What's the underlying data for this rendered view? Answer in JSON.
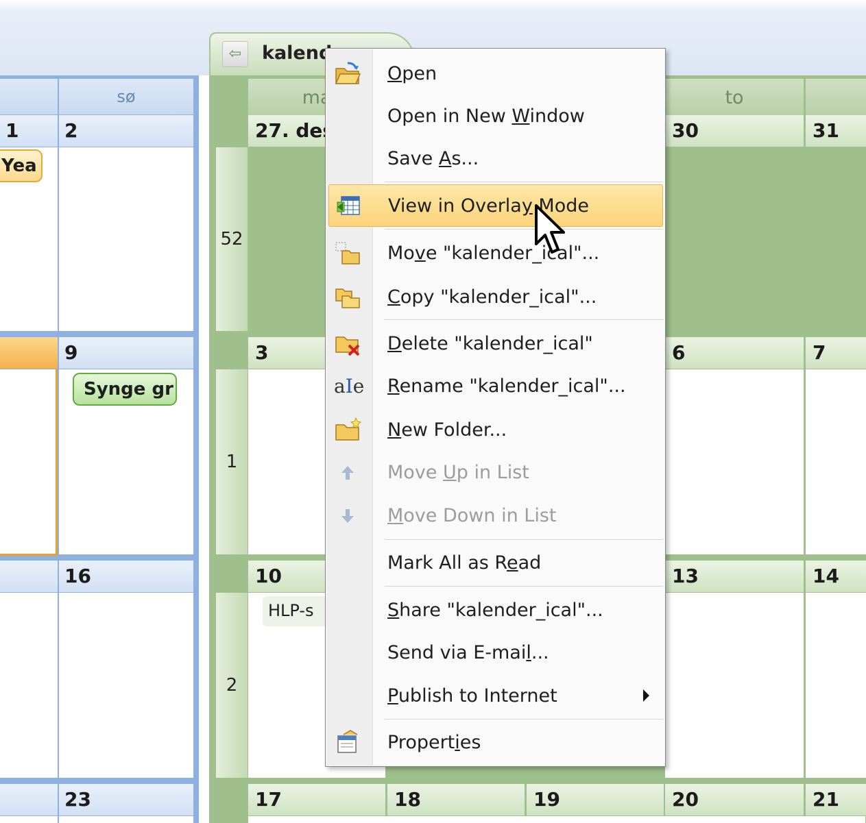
{
  "calendar_tab": {
    "title": "kalend"
  },
  "blue_calendar": {
    "day_header": "sø",
    "rows": [
      {
        "left_day": "1",
        "right_day": "2",
        "event": "Yea"
      },
      {
        "left_day": "",
        "right_day": "9",
        "event": "Synge gr"
      },
      {
        "left_day": "",
        "right_day": "16"
      },
      {
        "left_day": "",
        "right_day": "23"
      }
    ]
  },
  "green_calendar": {
    "day_headers": [
      "ma",
      "to"
    ],
    "weeks": [
      {
        "week": "52",
        "days": [
          "27. des",
          "",
          "",
          "30",
          "31"
        ]
      },
      {
        "week": "1",
        "days": [
          "3",
          "",
          "",
          "6",
          "7"
        ]
      },
      {
        "week": "2",
        "days": [
          "10",
          "",
          "",
          "13",
          "14"
        ],
        "event": "HLP-s"
      },
      {
        "week": "",
        "days": [
          "17",
          "18",
          "19",
          "20",
          "21"
        ]
      }
    ]
  },
  "context_menu": {
    "items": [
      {
        "pre": "",
        "key": "O",
        "post": "pen",
        "icon": "open-folder-icon"
      },
      {
        "pre": "Open in New ",
        "key": "W",
        "post": "indow",
        "icon": ""
      },
      {
        "pre": "Save ",
        "key": "A",
        "post": "s...",
        "icon": ""
      },
      {
        "pre": "View in Overla",
        "key": "y",
        "post": " Mode",
        "icon": "overlay-mode-icon",
        "highlighted": true
      },
      {
        "pre": "Mo",
        "key": "v",
        "post": "e \"kalender_ical\"...",
        "icon": "move-folder-icon"
      },
      {
        "pre": "",
        "key": "C",
        "post": "opy \"kalender_ical\"...",
        "icon": "copy-folder-icon"
      },
      {
        "pre": "",
        "key": "D",
        "post": "elete \"kalender_ical\"",
        "icon": "delete-folder-icon"
      },
      {
        "pre": "",
        "key": "R",
        "post": "ename \"kalender_ical\"...",
        "icon": "rename-icon"
      },
      {
        "pre": "",
        "key": "N",
        "post": "ew Folder...",
        "icon": "new-folder-icon"
      },
      {
        "pre": "Move ",
        "key": "U",
        "post": "p in List",
        "icon": "up-arrow-icon",
        "disabled": true
      },
      {
        "pre": "",
        "key": "M",
        "post": "ove Down in List",
        "icon": "down-arrow-icon",
        "disabled": true
      },
      {
        "pre": "Mark All as R",
        "key": "e",
        "post": "ad",
        "icon": ""
      },
      {
        "pre": "",
        "key": "S",
        "post": "hare \"kalender_ical\"...",
        "icon": ""
      },
      {
        "pre": "Send via E-mai",
        "key": "l",
        "post": "...",
        "icon": ""
      },
      {
        "pre": "",
        "key": "P",
        "post": "ublish to Internet",
        "icon": "",
        "submenu": true
      },
      {
        "pre": "Propert",
        "key": "i",
        "post": "es",
        "icon": "properties-icon"
      }
    ]
  }
}
